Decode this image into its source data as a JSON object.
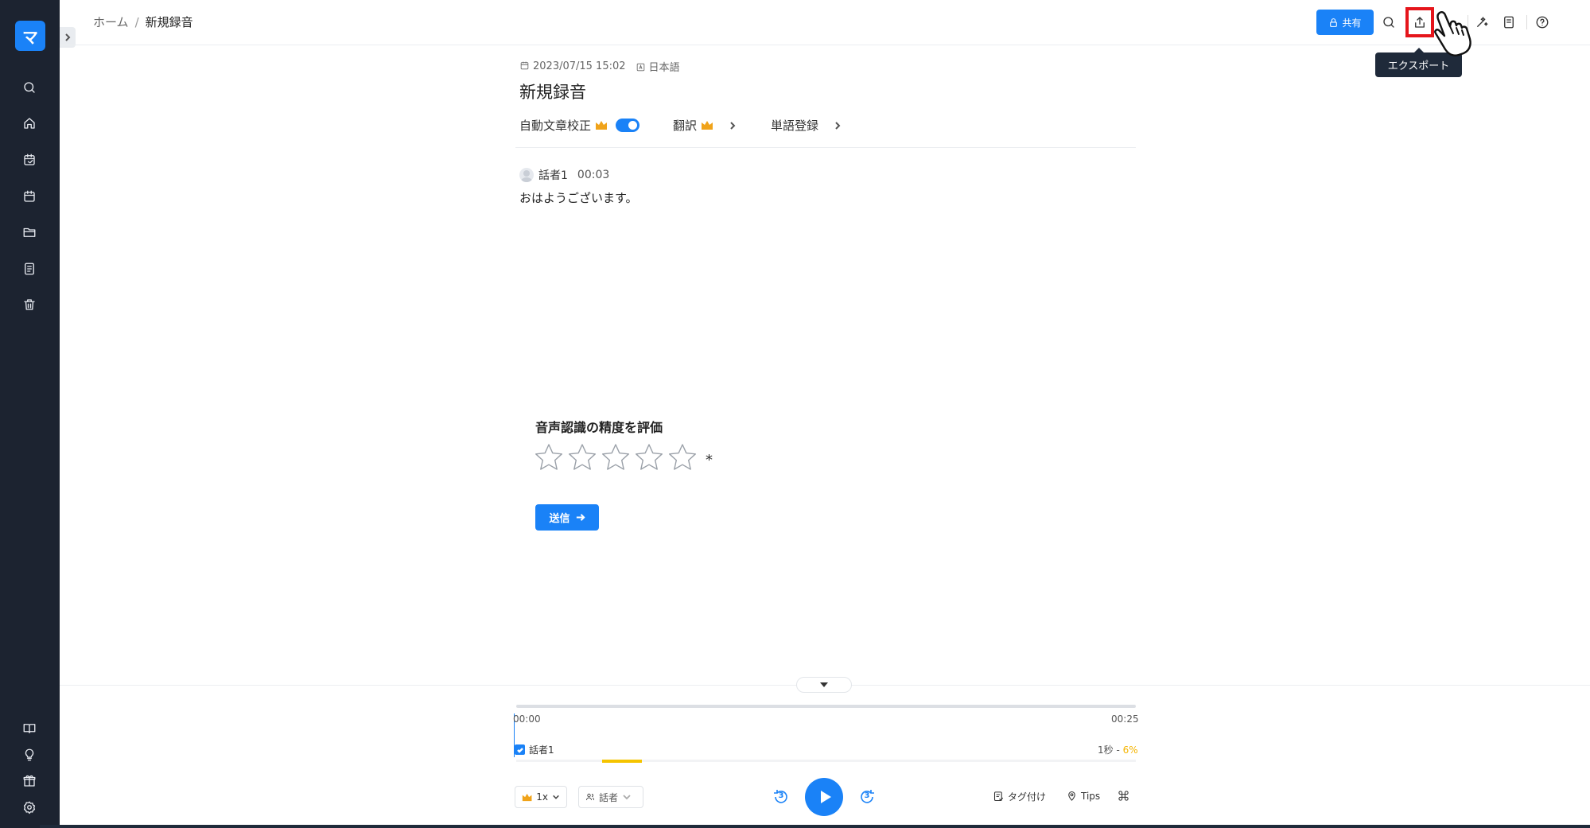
{
  "sidebar": {
    "logo": "マ",
    "top_icons": [
      "search-icon",
      "home-icon",
      "calendar-edit-icon",
      "calendar-icon",
      "folder-icon",
      "document-icon",
      "trash-icon"
    ],
    "bottom_icons": [
      "book-icon",
      "lightbulb-icon",
      "gift-icon",
      "settings-icon"
    ]
  },
  "breadcrumb": {
    "home": "ホーム",
    "separator": "/",
    "current": "新規録音"
  },
  "toolbar": {
    "share_label": "共有",
    "export_tooltip": "エクスポート"
  },
  "recording": {
    "datetime": "2023/07/15 15:02",
    "language": "日本語",
    "title": "新規録音",
    "auto_correct_label": "自動文章校正",
    "auto_correct_on": true,
    "translate_label": "翻訳",
    "dictionary_label": "単語登録"
  },
  "transcript": {
    "speaker": "話者1",
    "timestamp": "00:03",
    "text": "おはようございます。"
  },
  "rating": {
    "title": "音声認識の精度を評価",
    "star_count": 5,
    "selected": 0,
    "required_mark": "*",
    "submit_label": "送信"
  },
  "player": {
    "current_time": "00:00",
    "total_time": "00:25",
    "progress": 0,
    "speaker_name": "話者1",
    "speaker_duration": "1秒",
    "speaker_separator": " - ",
    "speaker_percent": "6%",
    "speed_label": "1x",
    "speaker_filter_label": "話者",
    "skip_back_seconds": "3",
    "skip_forward_seconds": "3",
    "tag_label": "タグ付け",
    "tips_label": "Tips"
  },
  "colors": {
    "accent": "#1a82f7",
    "sidebar_bg": "#1c2330",
    "highlight": "#e5151b",
    "speaker_bar": "#f5c400"
  }
}
